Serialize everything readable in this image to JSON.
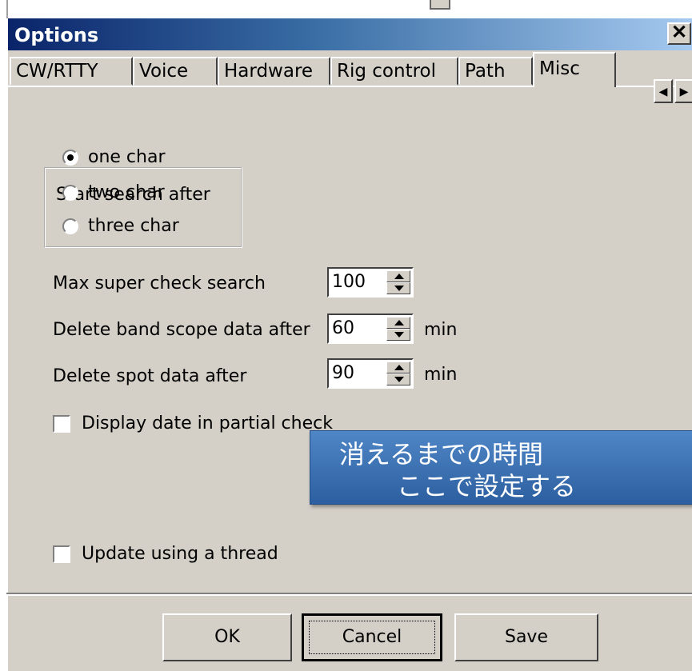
{
  "window": {
    "title": "Options",
    "close_glyph": "✕"
  },
  "tabs": [
    {
      "label": "CW/RTTY"
    },
    {
      "label": "Voice"
    },
    {
      "label": "Hardware"
    },
    {
      "label": "Rig control"
    },
    {
      "label": "Path"
    },
    {
      "label": "Misc",
      "active": true
    }
  ],
  "tab_scroll": {
    "left_icon": "arrow-left-icon",
    "right_icon": "arrow-right-icon",
    "left_glyph": "◀",
    "right_glyph": "▶"
  },
  "search_group": {
    "legend": "Start search after",
    "options": [
      {
        "label": "one char",
        "selected": true
      },
      {
        "label": "two char",
        "selected": false
      },
      {
        "label": "three char",
        "selected": false
      }
    ]
  },
  "fields": {
    "max_super_check": {
      "label": "Max super check search",
      "value": "100"
    },
    "band_scope": {
      "label": "Delete band scope data after",
      "value": "60",
      "unit": "min"
    },
    "spot_data": {
      "label": "Delete spot data after",
      "value": "90",
      "unit": "min"
    }
  },
  "checks": {
    "display_date": {
      "label": "Display date in partial check",
      "checked": false
    },
    "update_thread": {
      "label": "Update using a thread",
      "checked": false
    }
  },
  "callout": {
    "line1": "消えるまでの時間",
    "line2": "ここで設定する"
  },
  "buttons": {
    "ok": "OK",
    "cancel": "Cancel",
    "save": "Save"
  },
  "colors": {
    "face": "#d4d0c8",
    "title_start": "#0a246a",
    "callout": "#3f73b6"
  }
}
